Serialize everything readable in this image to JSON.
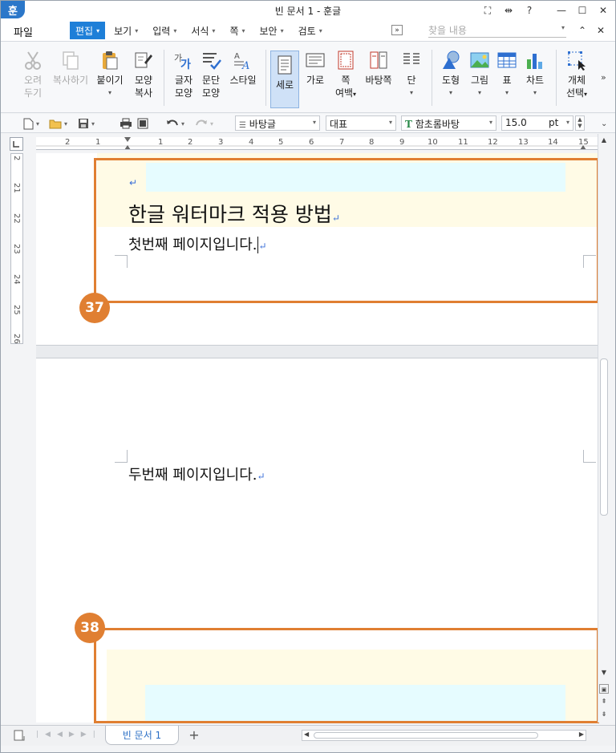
{
  "window": {
    "title": "빈 문서 1 - 훈글",
    "logo": "훈",
    "controls": [
      "⛶",
      "⇹",
      "?",
      "—",
      "☐",
      "✕"
    ]
  },
  "menubar": {
    "file": "파일",
    "items": [
      {
        "label": "편집",
        "active": true
      },
      {
        "label": "보기"
      },
      {
        "label": "입력"
      },
      {
        "label": "서식"
      },
      {
        "label": "쪽"
      },
      {
        "label": "보안"
      },
      {
        "label": "검토"
      }
    ],
    "more": "»",
    "search_placeholder": "찾을 내용",
    "collapse": "⌃",
    "close": "✕"
  },
  "ribbon": {
    "cut": [
      "오려",
      "두기"
    ],
    "copy": "복사하기",
    "paste": "붙이기",
    "format_copy": [
      "모양",
      "복사"
    ],
    "char_shape": [
      "글자",
      "모양"
    ],
    "para_shape": [
      "문단",
      "모양"
    ],
    "style": "스타일",
    "vertical": "세로",
    "horizontal": "가로",
    "page_margin": [
      "쪽",
      "여백"
    ],
    "master_page": "바탕쪽",
    "columns": "단",
    "shape": "도형",
    "picture": "그림",
    "table": "표",
    "chart": "차트",
    "object_select": [
      "개체",
      "선택"
    ],
    "expand": "»"
  },
  "format_toolbar": {
    "style_name": "바탕글",
    "font_lang": "대표",
    "font_name": "함초롬바탕",
    "font_size": "15.0",
    "font_unit": "pt"
  },
  "ruler": {
    "h_numbers": [
      "2",
      "1",
      "1",
      "2",
      "3",
      "4",
      "5",
      "6",
      "7",
      "8",
      "9",
      "10",
      "11",
      "12",
      "13",
      "14",
      "15"
    ],
    "v_numbers": [
      "2",
      "21",
      "22",
      "23",
      "24",
      "25",
      "26"
    ]
  },
  "document": {
    "title": "한글 워터마크 적용 방법",
    "page1_line": "첫번째 페이지입니다.",
    "page2_line": "두번째 페이지입니다.",
    "para_mark": "↵"
  },
  "callouts": [
    {
      "number": "37"
    },
    {
      "number": "38"
    }
  ],
  "statusbar": {
    "tab_label": "빈 문서 1",
    "add_tab": "+"
  },
  "colors": {
    "accent": "#1e7fd8",
    "callout": "#e07f32",
    "watermark_yellow": "#fffbe6",
    "watermark_cyan": "#e6fcff"
  }
}
